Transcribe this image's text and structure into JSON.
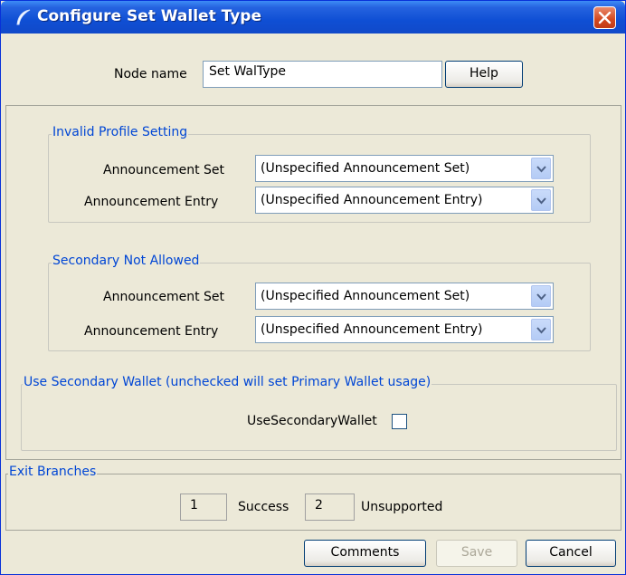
{
  "window": {
    "title": "Configure Set Wallet Type"
  },
  "node": {
    "label": "Node name",
    "value": "Set WalType",
    "help_label": "Help"
  },
  "invalid_profile": {
    "legend": "Invalid Profile Setting",
    "set_label": "Announcement Set",
    "set_value": "(Unspecified Announcement Set)",
    "entry_label": "Announcement Entry",
    "entry_value": "(Unspecified Announcement Entry)"
  },
  "secondary_not_allowed": {
    "legend": "Secondary Not Allowed",
    "set_label": "Announcement Set",
    "set_value": "(Unspecified Announcement Set)",
    "entry_label": "Announcement Entry",
    "entry_value": "(Unspecified Announcement Entry)"
  },
  "secondary_wallet": {
    "legend": "Use Secondary Wallet (unchecked will set Primary Wallet usage)",
    "checkbox_label": "UseSecondaryWallet",
    "checked": false
  },
  "exit_branches": {
    "legend": "Exit Branches",
    "items": [
      {
        "number": "1",
        "label": "Success"
      },
      {
        "number": "2",
        "label": "Unsupported"
      }
    ]
  },
  "footer": {
    "comments_label": "Comments",
    "save_label": "Save",
    "cancel_label": "Cancel"
  }
}
